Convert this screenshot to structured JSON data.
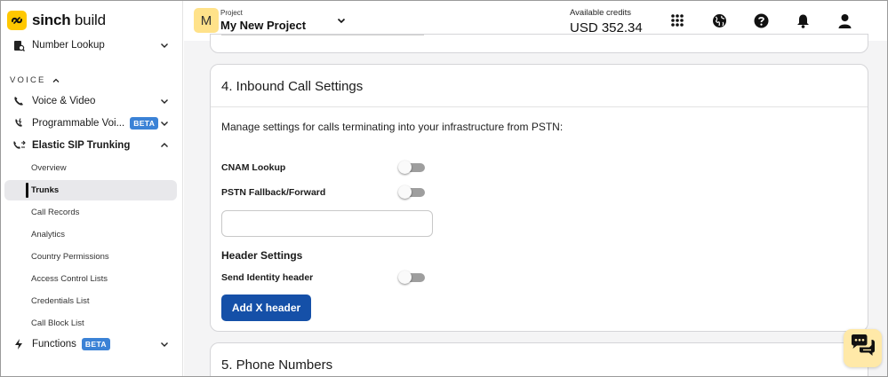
{
  "brand": {
    "name_bold": "sinch",
    "name_light": " build",
    "accent": "#ffc800"
  },
  "sidebar": {
    "number_lookup": "Number Lookup",
    "voice_section": "VOICE",
    "voice_video": "Voice & Video",
    "programmable_voice": "Programmable Voi...",
    "programmable_badge": "BETA",
    "elastic_sip": "Elastic SIP Trunking",
    "sub_items": [
      "Overview",
      "Trunks",
      "Call Records",
      "Analytics",
      "Country Permissions",
      "Access Control Lists",
      "Credentials List",
      "Call Block List"
    ],
    "active_sub_item": "Trunks",
    "functions": "Functions",
    "functions_badge": "BETA"
  },
  "topbar": {
    "project_initial": "M",
    "project_caption": "Project",
    "project_name": "My New Project",
    "credits_caption": "Available credits",
    "credits_value": "USD 352.34",
    "icons": [
      "apps-grid-icon",
      "globe-icon",
      "help-icon",
      "bell-icon",
      "user-icon"
    ]
  },
  "inbound": {
    "title": "4. Inbound Call Settings",
    "description": "Manage settings for calls terminating into your infrastructure from PSTN:",
    "cnam_label": "CNAM Lookup",
    "cnam_enabled": false,
    "pstn_label": "PSTN Fallback/Forward",
    "pstn_enabled": false,
    "fallback_value": "",
    "header_settings": "Header Settings",
    "identity_label": "Send Identity header",
    "identity_enabled": false,
    "add_header_button": "Add X header"
  },
  "phone_numbers": {
    "title": "5. Phone Numbers"
  },
  "colors": {
    "primary_button": "#1550a8",
    "badge": "#3b82d6",
    "chat": "#ffe9a8"
  }
}
